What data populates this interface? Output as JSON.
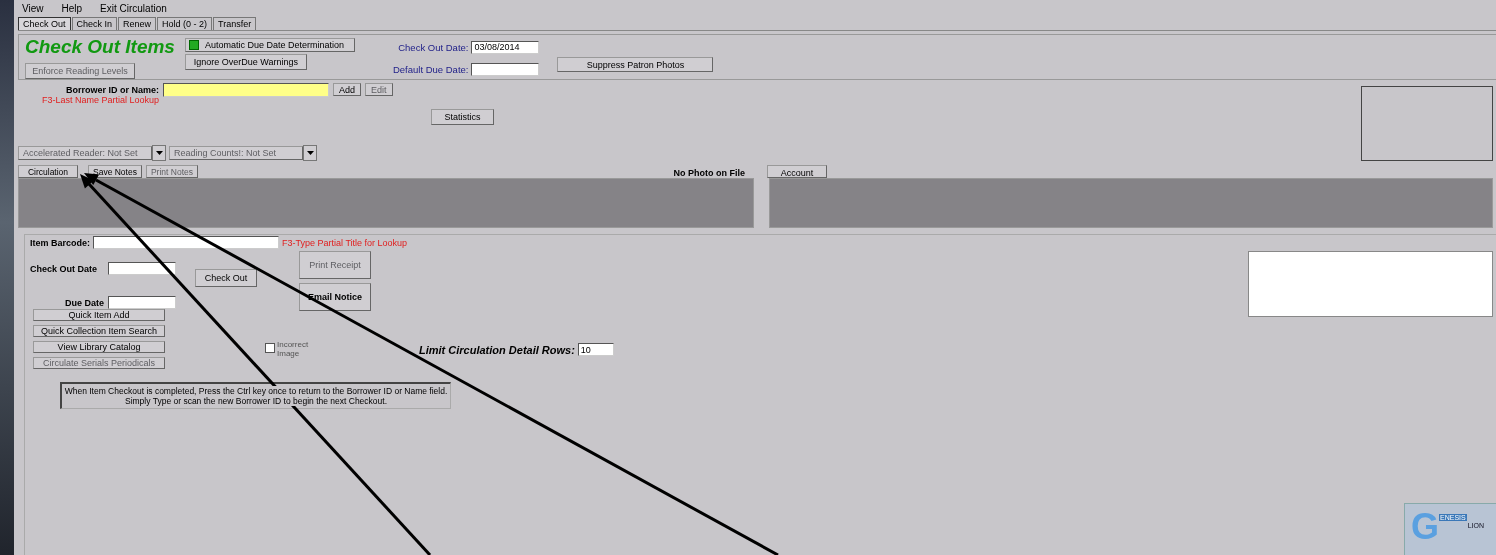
{
  "menu": [
    {
      "label": "View"
    },
    {
      "label": "Help"
    },
    {
      "label": "Exit Circulation"
    }
  ],
  "tabs": [
    {
      "label": "Check Out",
      "selected": true
    },
    {
      "label": "Check In",
      "selected": false
    },
    {
      "label": "Renew",
      "selected": false
    },
    {
      "label": "Hold (0 - 2)",
      "selected": false
    },
    {
      "label": "Transfer",
      "selected": false
    }
  ],
  "header": {
    "title": "Check Out Items",
    "enforce_reading": {
      "label": "Enforce Reading Levels",
      "disabled": true
    },
    "auto_due": {
      "label": "Automatic Due Date Determination",
      "checked": true
    },
    "ignore_overdue": "Ignore OverDue Warnings",
    "check_out_date": {
      "label": "Check Out Date:",
      "value": "03/08/2014"
    },
    "default_due_date": {
      "label": "Default Due Date:"
    },
    "suppress_photos": "Suppress Patron Photos"
  },
  "borrower": {
    "label": "Borrower ID or Name:",
    "hint": "F3-Last Name Partial Lookup",
    "add": {
      "label": "Add",
      "disabled": false
    },
    "edit": {
      "label": "Edit",
      "disabled": true
    },
    "statistics": "Statistics"
  },
  "reading_programs": [
    {
      "label": "Accelerated Reader: Not Set",
      "disabled": true
    },
    {
      "label": "Reading Counts!: Not Set",
      "disabled": true
    }
  ],
  "notes_buttons": [
    {
      "label": "Circulation",
      "disabled": false
    },
    {
      "label": "Save Notes",
      "disabled": false
    },
    {
      "label": "Print Notes",
      "disabled": true
    }
  ],
  "photo_status": "No Photo on File",
  "account": "Account",
  "item": {
    "barcode_label": "Item Barcode:",
    "barcode_hint": "F3-Type Partial Title for Lookup",
    "check_out_date_label": "Check Out Date",
    "due_date_label": "Due Date",
    "check_out": "Check Out",
    "receipt_buttons": [
      {
        "label": "Print Receipt",
        "disabled": true
      },
      {
        "label": "Email Notice",
        "disabled": false
      }
    ],
    "side_buttons": [
      {
        "label": "Quick Item Add",
        "disabled": false
      },
      {
        "label": "Quick Collection Item Search",
        "disabled": false
      },
      {
        "label": "View Library Catalog",
        "disabled": false
      },
      {
        "label": "Circulate Serials Periodicals",
        "disabled": true
      }
    ],
    "incorrect_image": {
      "label": "Incorrect Image",
      "checked": false
    },
    "limit_rows": {
      "label": "Limit Circulation Detail Rows:",
      "value": "10"
    },
    "note_lines": [
      "When Item Checkout is completed, Press the Ctrl key once to return to the Borrower ID or Name field.",
      "Simply Type or scan the new Borrower ID to begin the next Checkout."
    ]
  },
  "logo": {
    "letter": "G",
    "word": "ENESIS",
    "tag": "LION"
  }
}
